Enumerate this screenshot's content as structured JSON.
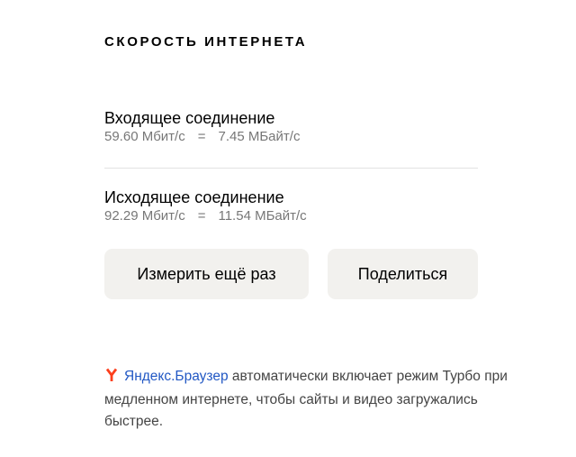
{
  "title": "СКОРОСТЬ ИНТЕРНЕТА",
  "incoming": {
    "label": "Входящее соединение",
    "mbits": "59.60 Мбит/с",
    "equals": "=",
    "mbytes": "7.45 МБайт/с"
  },
  "outgoing": {
    "label": "Исходящее соединение",
    "mbits": "92.29 Мбит/с",
    "equals": "=",
    "mbytes": "11.54 МБайт/с"
  },
  "buttons": {
    "measure_again": "Измерить ещё раз",
    "share": "Поделиться"
  },
  "promo": {
    "icon": "yandex-logo-icon",
    "link_text": "Яндекс.Браузер",
    "text": " автоматически включает режим Турбо при медленном интернете, чтобы сайты и видео загружались быстрее."
  },
  "colors": {
    "brand_red": "#fc3f1d",
    "link_blue": "#2258c4",
    "button_bg": "#f2f1ee",
    "secondary_text": "#777777"
  }
}
